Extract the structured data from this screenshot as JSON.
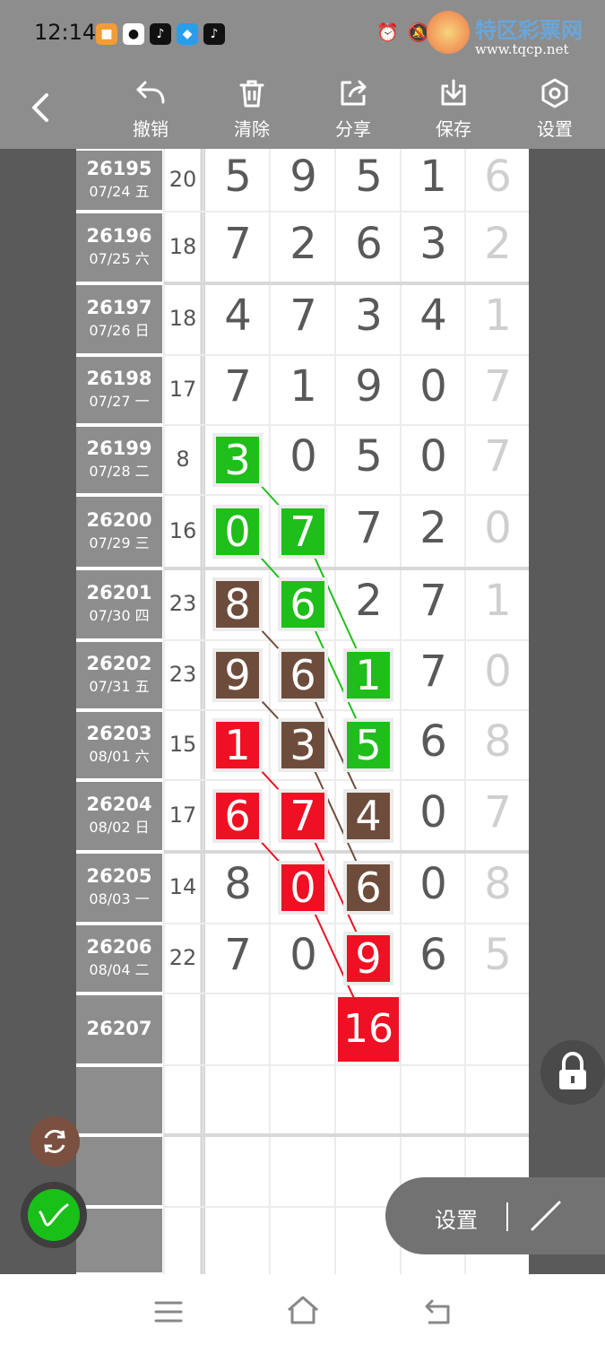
{
  "status_bar": {
    "time": "12:14",
    "icons": [
      "alarm-icon",
      "mute-icon",
      "wifi-icon",
      "signal-icon",
      "battery-icon"
    ]
  },
  "watermark": {
    "name": "特区彩票网",
    "url": "www.tqcp.net"
  },
  "toolbar": {
    "undo": "撤销",
    "clear": "清除",
    "share": "分享",
    "save": "保存",
    "settings": "设置"
  },
  "rows": [
    {
      "issue": "26195",
      "date": "07/24 五",
      "sum": "20",
      "digits": [
        "5",
        "9",
        "5",
        "1",
        "6"
      ]
    },
    {
      "issue": "26196",
      "date": "07/25 六",
      "sum": "18",
      "digits": [
        "7",
        "2",
        "6",
        "3",
        "2"
      ]
    },
    {
      "issue": "26197",
      "date": "07/26 日",
      "sum": "18",
      "digits": [
        "4",
        "7",
        "3",
        "4",
        "1"
      ]
    },
    {
      "issue": "26198",
      "date": "07/27 一",
      "sum": "17",
      "digits": [
        "7",
        "1",
        "9",
        "0",
        "7"
      ]
    },
    {
      "issue": "26199",
      "date": "07/28 二",
      "sum": "8",
      "digits": [
        "3",
        "0",
        "5",
        "0",
        "7"
      ]
    },
    {
      "issue": "26200",
      "date": "07/29 三",
      "sum": "16",
      "digits": [
        "0",
        "7",
        "7",
        "2",
        "0"
      ]
    },
    {
      "issue": "26201",
      "date": "07/30 四",
      "sum": "23",
      "digits": [
        "8",
        "6",
        "2",
        "7",
        "1"
      ]
    },
    {
      "issue": "26202",
      "date": "07/31 五",
      "sum": "23",
      "digits": [
        "9",
        "6",
        "1",
        "7",
        "0"
      ]
    },
    {
      "issue": "26203",
      "date": "08/01 六",
      "sum": "15",
      "digits": [
        "1",
        "3",
        "5",
        "6",
        "8"
      ]
    },
    {
      "issue": "26204",
      "date": "08/02 日",
      "sum": "17",
      "digits": [
        "6",
        "7",
        "4",
        "0",
        "7"
      ]
    },
    {
      "issue": "26205",
      "date": "08/03 一",
      "sum": "14",
      "digits": [
        "8",
        "0",
        "6",
        "0",
        "8"
      ]
    },
    {
      "issue": "26206",
      "date": "08/04 二",
      "sum": "22",
      "digits": [
        "7",
        "0",
        "9",
        "6",
        "5"
      ]
    },
    {
      "issue": "26207",
      "date": "",
      "sum": "",
      "digits": [
        "",
        "",
        "",
        "",
        ""
      ]
    }
  ],
  "prediction": "16",
  "settings_bar": {
    "label": "设置"
  },
  "colors": {
    "green": "#1fbe1a",
    "brown": "#6e4c3c",
    "red": "#ef1023",
    "toolbar": "#8d8d8d"
  }
}
